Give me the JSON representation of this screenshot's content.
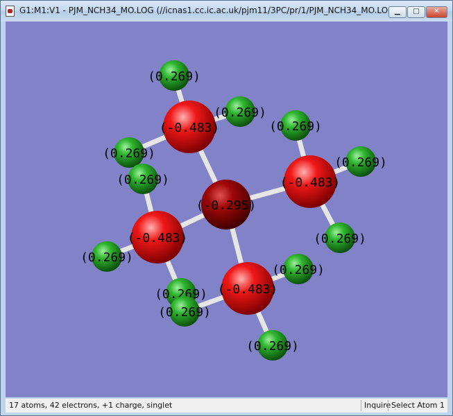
{
  "window": {
    "title": "G1:M1:V1 - PJM_NCH34_MO.LOG (//icnas1.cc.ic.ac.uk/pjm11/3PC/pr/1/PJM_NCH34_MO.LOG)",
    "buttons": {
      "minimize": "▁",
      "maximize": "□",
      "close": "✕"
    }
  },
  "viewport": {
    "background": "#8282c8",
    "atoms": [
      {
        "element": "H",
        "label": "(0.269)"
      },
      {
        "element": "C",
        "label": "(-0.483)"
      },
      {
        "element": "H",
        "label": "(0.269)"
      },
      {
        "element": "H",
        "label": "(0.269)"
      },
      {
        "element": "H",
        "label": "(0.269)"
      },
      {
        "element": "H",
        "label": "(0.269)"
      },
      {
        "element": "C",
        "label": "(-0.483)"
      },
      {
        "element": "H",
        "label": "(0.269)"
      },
      {
        "element": "N",
        "label": "(-0.295)"
      },
      {
        "element": "C",
        "label": "(-0.483)"
      },
      {
        "element": "H",
        "label": "(0.269)"
      },
      {
        "element": "H",
        "label": "(0.269)"
      },
      {
        "element": "H",
        "label": "(0.269)"
      },
      {
        "element": "H",
        "label": "(0.269)"
      },
      {
        "element": "C",
        "label": "(-0.483)"
      },
      {
        "element": "H",
        "label": "(0.269)"
      },
      {
        "element": "H",
        "label": "(0.269)"
      }
    ],
    "colors": {
      "H": "#2e9a2e",
      "C": "#e02020",
      "N": "#a01010",
      "bond": "#e6e6e6",
      "label": "#000000"
    }
  },
  "statusbar": {
    "info": "17 atoms, 42 electrons, +1 charge, singlet",
    "mode": "Inquire",
    "action": "Select Atom 1"
  }
}
